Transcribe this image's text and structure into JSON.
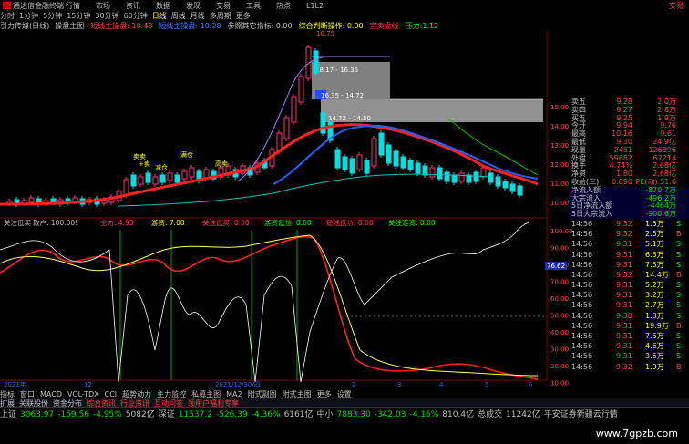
{
  "titlebar": {
    "app_title": "通达信金融终端",
    "menu": [
      "行情",
      "市场",
      "资讯",
      "数据",
      "发现",
      "交易",
      "工具",
      "热点",
      "L1L2"
    ],
    "right_title": "交易"
  },
  "periodbar": {
    "items": [
      "分时",
      "1分钟",
      "5分钟",
      "15分钟",
      "30分钟",
      "60分钟",
      "日线",
      "周线",
      "月线",
      "多周期",
      "更多"
    ],
    "active": "日线"
  },
  "indbar": {
    "stock": "引力传媒(日线)",
    "items": [
      {
        "label": "操盘主图",
        "color": "#c0c0c0"
      },
      {
        "label": "短线主操盘: 10.48",
        "color": "#ff4040"
      },
      {
        "label": "短线主操盘: 10.28",
        "color": "#4080ff"
      },
      {
        "label": "参照其它指标: 0.00",
        "color": "#c0c0c0"
      },
      {
        "label": "综合判断操作: 0.00",
        "color": "#ffff00"
      },
      {
        "label": "宜卖盘线",
        "color": "#ff4040"
      },
      {
        "label": "压力:1.12",
        "color": "#00ff00"
      }
    ]
  },
  "chart_annotations": {
    "high_label": "10.75",
    "range_labels": [
      "18.17 - 16.35",
      "16.35 - 14.72",
      "14.72 - 14.50"
    ],
    "buy_labels": [
      "卖卖",
      "+卖",
      "减仓",
      "满仓",
      "高卖"
    ],
    "price_axis": [
      "15.00",
      "14.00",
      "13.00",
      "12.00",
      "11.00",
      "10.00"
    ],
    "osc_axis": [
      "100.00",
      "90.00",
      "80.00",
      "70.00",
      "60.00",
      "50.00",
      "40.00",
      "30.00",
      "20.00",
      "10.00"
    ],
    "osc_marker": "76.62",
    "osc_title": [
      {
        "label": "关注低买",
        "color": "#c0c0c0"
      },
      {
        "label": "散户: 100.00!",
        "color": "#c0c0c0"
      },
      {
        "label": "主力: 4.93",
        "color": "#ff4040"
      },
      {
        "label": "游资: 7.00",
        "color": "#ffff00"
      },
      {
        "label": "关注低买: 0.00",
        "color": "#ff4040"
      },
      {
        "label": "游资低位: 0.00",
        "color": "#00ff00"
      },
      {
        "label": "短线低价: 0.00",
        "color": "#ff4040"
      },
      {
        "label": "关注游资: 0.00",
        "color": "#00ff00"
      }
    ],
    "date_labels": [
      "2021年",
      "12",
      "2021/12/30/四",
      "2",
      "3",
      "4",
      "5",
      "6"
    ]
  },
  "quote_panel": {
    "rows": [
      {
        "k": "卖五",
        "v1": "9.28",
        "v2": "2.0万"
      },
      {
        "k": "卖四",
        "v1": "9.27",
        "v2": "2.8万"
      },
      {
        "k": "买五",
        "v1": "9.25",
        "v2": "1.9万"
      },
      {
        "k": "今开",
        "v1": "9.94",
        "v2": "9.76"
      },
      {
        "k": "最高",
        "v1": "10.16",
        "v2": "9.61"
      },
      {
        "k": "最低",
        "v1": "9.30",
        "v2": "24.9亿"
      },
      {
        "k": "现量",
        "v1": "2451",
        "v2": "126896"
      },
      {
        "k": "外盘",
        "v1": "59682",
        "v2": "67214"
      },
      {
        "k": "换手",
        "v1": "4.74%",
        "v2": "2.68亿"
      },
      {
        "k": "净资",
        "v1": "1.80",
        "v2": "2.68亿"
      },
      {
        "k": "收益(三)",
        "v1": "0.090",
        "v2": "PE(动) 51.6"
      },
      {
        "k": "净流入额",
        "v1": "",
        "v2": "-870.7万"
      },
      {
        "k": "大宗流入",
        "v1": "",
        "v2": "-496.2万"
      },
      {
        "k": "5日净流入额",
        "v1": "",
        "v2": "-4464万"
      },
      {
        "k": "5日大宗流入",
        "v1": "",
        "v2": "-900.6万"
      }
    ],
    "ticks": [
      {
        "t": "14:56",
        "p": "9.32",
        "q": "1.5万",
        "s": "S"
      },
      {
        "t": "14:56",
        "p": "9.32",
        "q": "2.5万",
        "s": "B"
      },
      {
        "t": "14:56",
        "p": "9.31",
        "q": "5.1万",
        "s": "S"
      },
      {
        "t": "14:56",
        "p": "9.31",
        "q": "6.3万",
        "s": "S"
      },
      {
        "t": "14:56",
        "p": "9.31",
        "q": "7.5万",
        "s": "S"
      },
      {
        "t": "14:56",
        "p": "9.32",
        "q": "14.4万",
        "s": "B"
      },
      {
        "t": "14:56",
        "p": "9.31",
        "q": "5.2万",
        "s": "S"
      },
      {
        "t": "14:56",
        "p": "9.31",
        "q": "3.2万",
        "s": "S"
      },
      {
        "t": "14:56",
        "p": "9.31",
        "q": "2.7万",
        "s": "S"
      },
      {
        "t": "14:56",
        "p": "9.30",
        "q": "1.3万",
        "s": "S"
      },
      {
        "t": "14:56",
        "p": "9.31",
        "q": "19.9万",
        "s": "B"
      },
      {
        "t": "14:56",
        "p": "9.31",
        "q": "7.5万",
        "s": "S"
      },
      {
        "t": "14:56",
        "p": "9.31",
        "q": "4.6万",
        "s": "S"
      },
      {
        "t": "14:56",
        "p": "9.31",
        "q": "3.5万",
        "s": "S"
      },
      {
        "t": "14:56",
        "p": "9.32",
        "q": "1.9万",
        "s": "B"
      }
    ]
  },
  "tabs": [
    "指标",
    "窗口",
    "MACD",
    "VOL-TDX",
    "CCI",
    "超势动力",
    "主力监控",
    "私募主图",
    "MA2",
    "附式副图",
    "附式主图",
    "更多",
    "设置"
  ],
  "tabs2": [
    "扩展",
    "关联股份",
    "资金分布",
    "综合资讯",
    "行业资讯",
    "互动问答",
    "领用户福利专享"
  ],
  "statusbar": [
    {
      "text": "上证",
      "cls": "w"
    },
    {
      "text": "3063.97",
      "cls": "dn"
    },
    {
      "text": "-159.56",
      "cls": "dn"
    },
    {
      "text": "-4.95%",
      "cls": "dn"
    },
    {
      "text": "5082亿",
      "cls": "w"
    },
    {
      "text": "深证",
      "cls": "w"
    },
    {
      "text": "11537.2",
      "cls": "dn"
    },
    {
      "text": "-526.39",
      "cls": "dn"
    },
    {
      "text": "-4.36%",
      "cls": "dn"
    },
    {
      "text": "6161亿",
      "cls": "w"
    },
    {
      "text": "中小",
      "cls": "w"
    },
    {
      "text": "7883.30",
      "cls": "dn"
    },
    {
      "text": "-342.03",
      "cls": "dn"
    },
    {
      "text": "-4.16%",
      "cls": "dn"
    },
    {
      "text": "810.4亿",
      "cls": "w"
    },
    {
      "text": "总成交",
      "cls": "w"
    },
    {
      "text": "11242亿",
      "cls": "w"
    },
    {
      "text": "平安证券新疆云行情",
      "cls": "w"
    }
  ],
  "watermark": "www.7gpzb.com",
  "colors": {
    "up": "#ff4040",
    "down": "#00e000",
    "ma_red": "#ff2020",
    "ma_blue": "#2060ff",
    "band": "#a0a0a0"
  }
}
